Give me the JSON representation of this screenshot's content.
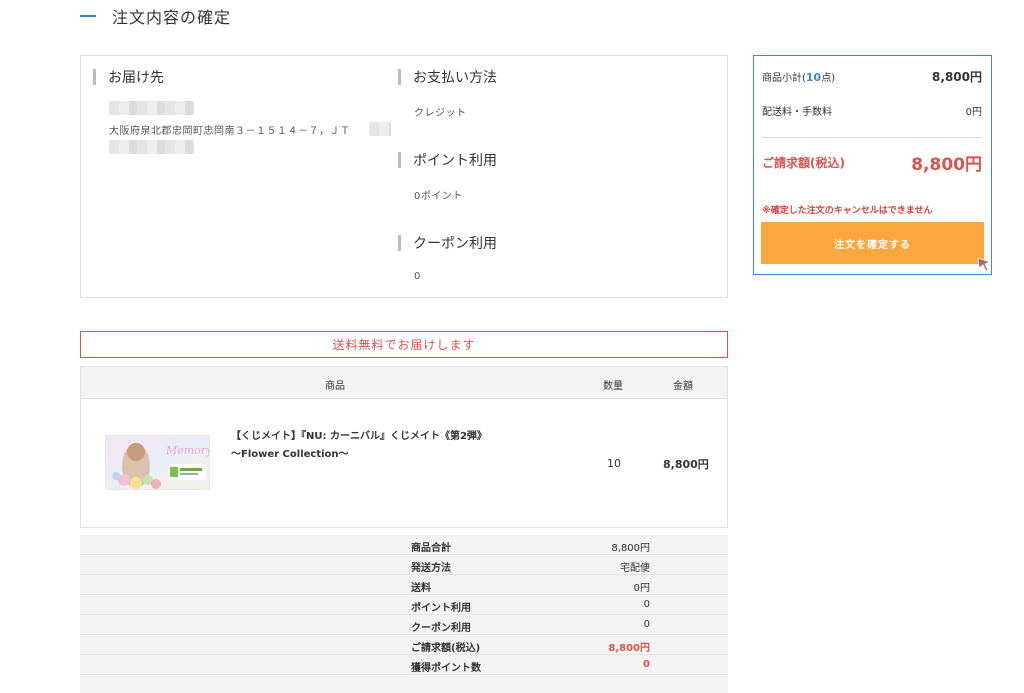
{
  "page": {
    "title": "注文内容の確定"
  },
  "info": {
    "delivery": {
      "heading": "お届け先",
      "address": "大阪府泉北郡忠岡町忠岡南３－１５１４－７，ＪＴ"
    },
    "payment": {
      "heading": "お支払い方法",
      "value": "クレジット"
    },
    "points": {
      "heading": "ポイント利用",
      "value": "0ポイント"
    },
    "coupon": {
      "heading": "クーポン利用",
      "value": "0"
    }
  },
  "summary": {
    "subtotal_prefix": "商品小計(",
    "subtotal_count": "10",
    "subtotal_suffix": "点)",
    "subtotal_amount": "8,800円",
    "shipping_label": "配送料・手数料",
    "shipping_amount": "0円",
    "total_label": "ご請求額(税込)",
    "total_amount": "8,800円",
    "warning": "※確定した注文のキャンセルはできません",
    "confirm_button": "注文を確定する"
  },
  "notice": "送料無料でお届けします",
  "table": {
    "headers": {
      "product": "商品",
      "quantity": "数量",
      "amount": "金額"
    },
    "item": {
      "name_line1": "【くじメイト】『NU: カーニバル』くじメイト《第2弾》",
      "name_line2": "～Flower Collection～",
      "quantity": "10",
      "price": "8,800円"
    }
  },
  "totals": [
    {
      "label": "商品合計",
      "value": "8,800円"
    },
    {
      "label": "発送方法",
      "value": "宅配便"
    },
    {
      "label": "送料",
      "value": "0円"
    },
    {
      "label": "ポイント利用",
      "value": "0"
    },
    {
      "label": "クーポン利用",
      "value": "0"
    },
    {
      "label": "ご請求額(税込)",
      "value": "8,800円",
      "highlight": true
    },
    {
      "label": "獲得ポイント数",
      "value": "0",
      "highlight": true
    }
  ],
  "colors": {
    "accent_blue": "#3b8bc7",
    "accent_red": "#d9534f",
    "button_orange": "#f9a73e"
  }
}
